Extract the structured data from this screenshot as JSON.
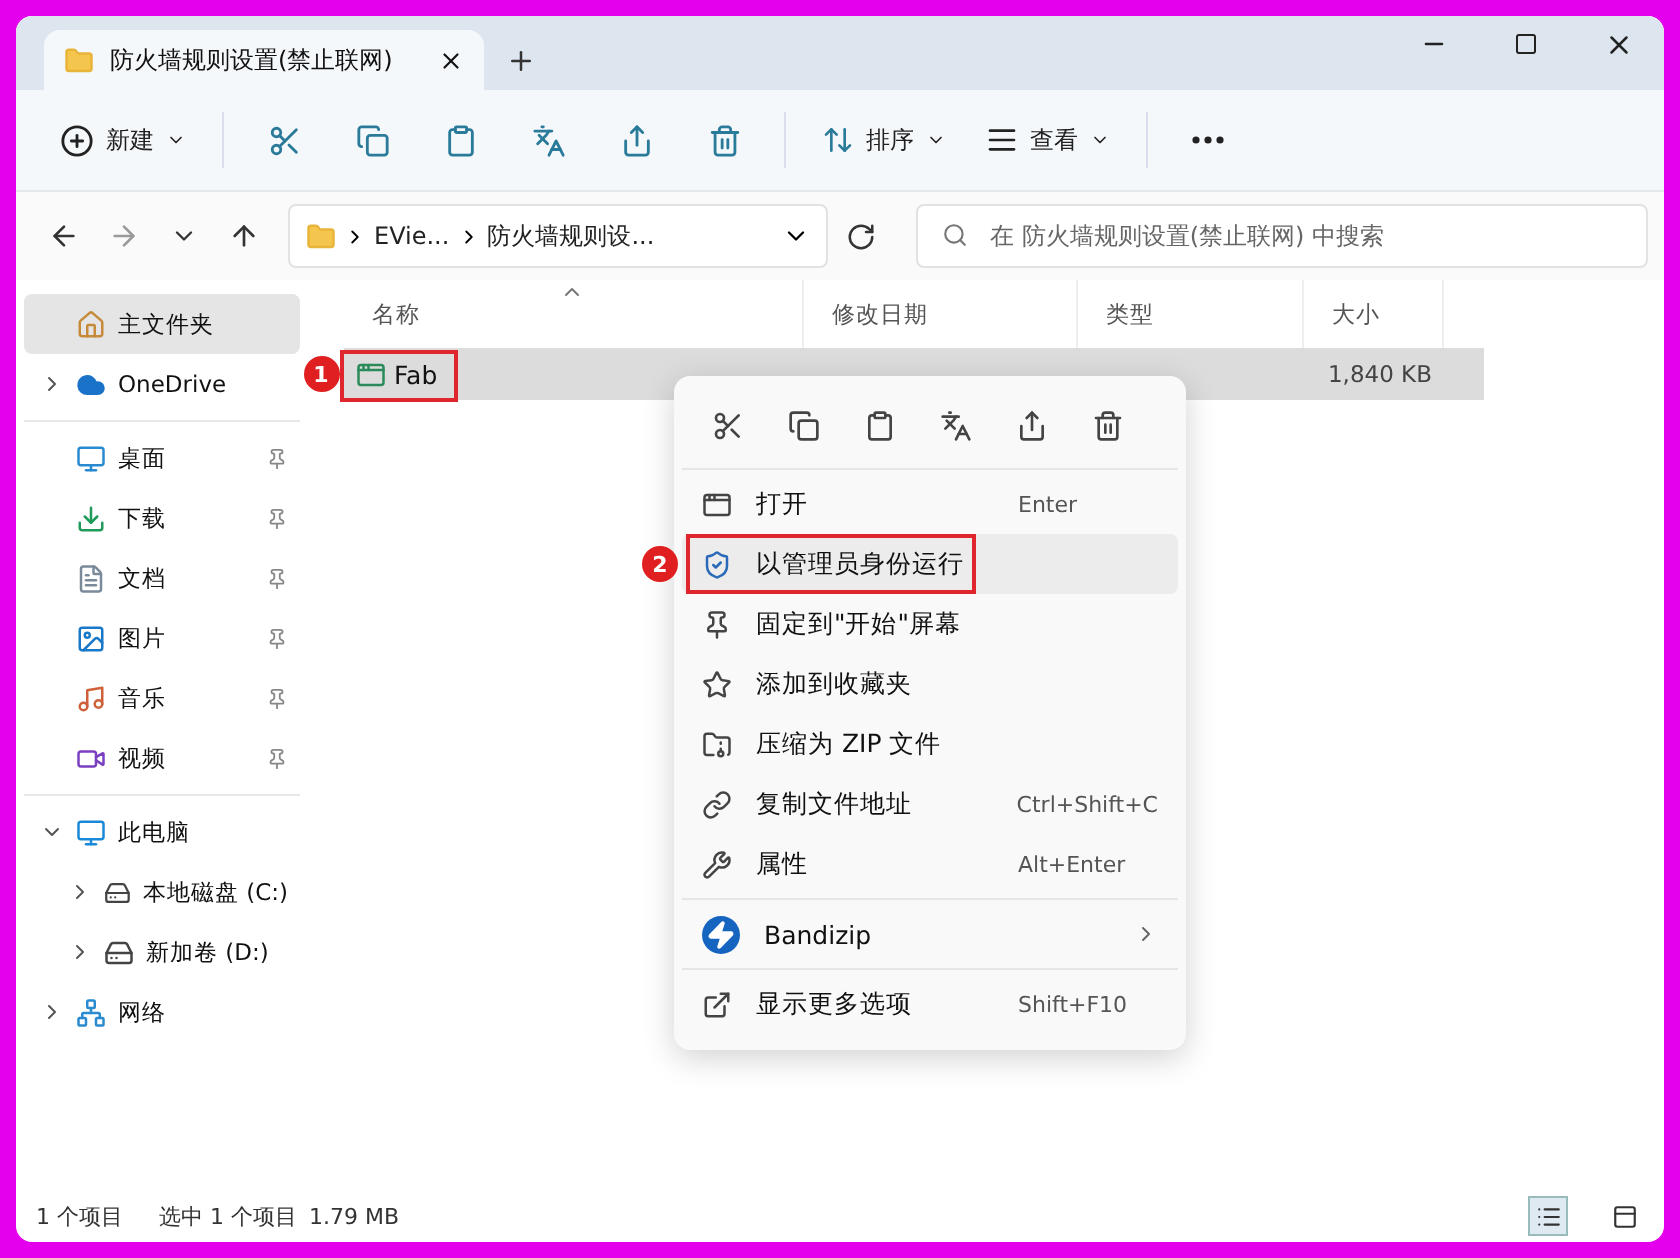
{
  "tab": {
    "title": "防火墙规则设置(禁止联网)",
    "selected": true
  },
  "toolbar": {
    "new_label": "新建",
    "sort_label": "排序",
    "view_label": "查看"
  },
  "address": {
    "crumbs": [
      "EVie...",
      "防火墙规则设..."
    ],
    "search_placeholder": "在 防火墙规则设置(禁止联网) 中搜索"
  },
  "sidebar": {
    "groups": [
      [
        {
          "label": "主文件夹",
          "kind": "home",
          "selected": true
        },
        {
          "label": "OneDrive",
          "kind": "cloud",
          "selected": false,
          "expanded": false
        }
      ],
      [
        {
          "label": "桌面",
          "kind": "desktop",
          "selected": false,
          "pinned": true
        },
        {
          "label": "下载",
          "kind": "download",
          "selected": false,
          "pinned": true
        },
        {
          "label": "文档",
          "kind": "document",
          "selected": false,
          "pinned": true
        },
        {
          "label": "图片",
          "kind": "picture",
          "selected": false,
          "pinned": true
        },
        {
          "label": "音乐",
          "kind": "music",
          "selected": false,
          "pinned": true
        },
        {
          "label": "视频",
          "kind": "video",
          "selected": false,
          "pinned": true
        }
      ],
      [
        {
          "label": "此电脑",
          "kind": "pc",
          "selected": false,
          "expanded": true,
          "children": [
            {
              "label": "本地磁盘 (C:)",
              "kind": "drive",
              "selected": false,
              "expanded": false
            },
            {
              "label": "新加卷 (D:)",
              "kind": "drive",
              "selected": false,
              "expanded": false
            }
          ]
        },
        {
          "label": "网络",
          "kind": "network",
          "selected": false,
          "expanded": false
        }
      ]
    ]
  },
  "columns": [
    {
      "label": "名称",
      "sorted": true
    },
    {
      "label": "修改日期",
      "sorted": false
    },
    {
      "label": "类型",
      "sorted": false
    },
    {
      "label": "大小",
      "sorted": false
    }
  ],
  "rows": [
    {
      "name": "Fab",
      "size": "1,840 KB",
      "selected": true
    }
  ],
  "context_menu": {
    "groups": [
      [
        {
          "label": "打开",
          "shortcut": "Enter",
          "kind": "open",
          "highlighted": false
        },
        {
          "label": "以管理员身份运行",
          "kind": "admin",
          "highlighted": true
        },
        {
          "label": "固定到\"开始\"屏幕",
          "kind": "pin",
          "highlighted": false
        },
        {
          "label": "添加到收藏夹",
          "kind": "star",
          "highlighted": false
        },
        {
          "label": "压缩为 ZIP 文件",
          "kind": "zip",
          "highlighted": false
        },
        {
          "label": "复制文件地址",
          "shortcut": "Ctrl+Shift+C",
          "kind": "path",
          "highlighted": false
        },
        {
          "label": "属性",
          "shortcut": "Alt+Enter",
          "kind": "props",
          "highlighted": false
        }
      ],
      [
        {
          "label": "Bandizip",
          "kind": "bandizip",
          "highlighted": false,
          "submenu": true
        }
      ],
      [
        {
          "label": "显示更多选项",
          "shortcut": "Shift+F10",
          "kind": "more",
          "highlighted": false
        }
      ]
    ]
  },
  "annotations": [
    {
      "number": "1"
    },
    {
      "number": "2"
    }
  ],
  "status": {
    "count": "1 个项目",
    "selection": "选中 1 个项目",
    "size": "1.79 MB",
    "views": [
      {
        "kind": "details",
        "selected": true
      },
      {
        "kind": "tiles",
        "selected": false
      }
    ]
  }
}
